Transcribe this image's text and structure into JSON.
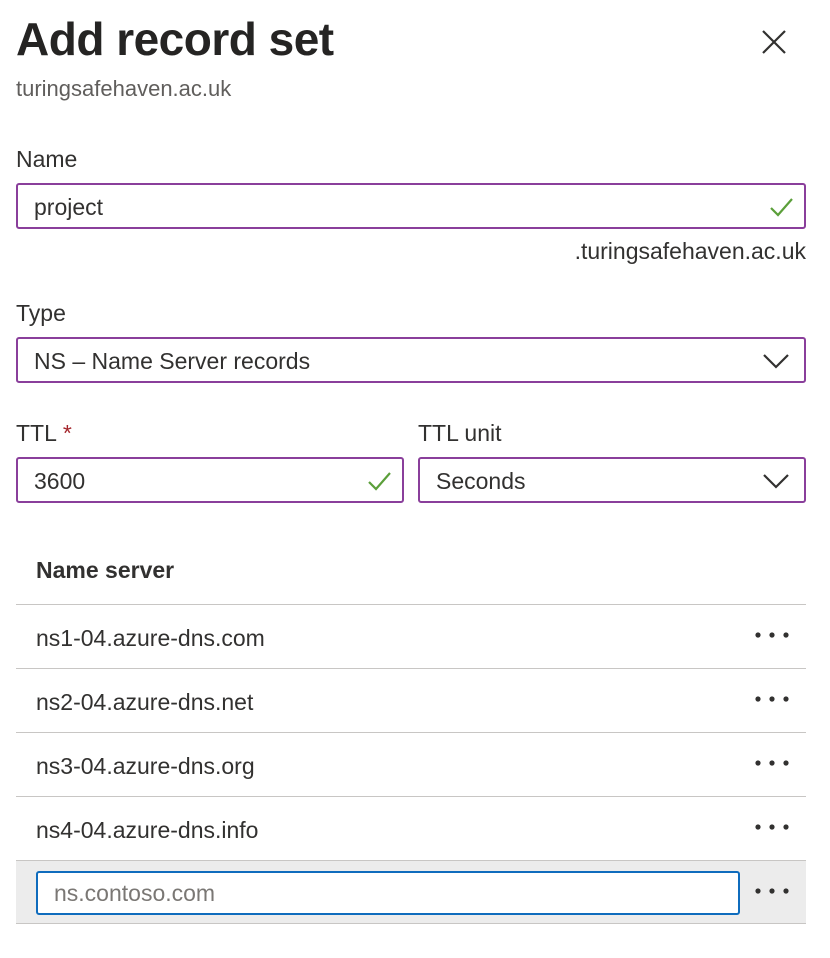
{
  "header": {
    "title": "Add record set",
    "subtitle": "turingsafehaven.ac.uk"
  },
  "form": {
    "name": {
      "label": "Name",
      "value": "project",
      "suffix": ".turingsafehaven.ac.uk"
    },
    "type": {
      "label": "Type",
      "value": "NS – Name Server records"
    },
    "ttl": {
      "label": "TTL",
      "required_marker": "*",
      "value": "3600"
    },
    "ttl_unit": {
      "label": "TTL unit",
      "value": "Seconds"
    }
  },
  "name_servers": {
    "header": "Name server",
    "items": [
      "ns1-04.azure-dns.com",
      "ns2-04.azure-dns.net",
      "ns3-04.azure-dns.org",
      "ns4-04.azure-dns.info"
    ],
    "new_placeholder": "ns.contoso.com"
  },
  "colors": {
    "field_border": "#8a3f9b",
    "valid_check": "#5b9f3a",
    "focus_border": "#0f6cbd",
    "required": "#a4262c"
  }
}
